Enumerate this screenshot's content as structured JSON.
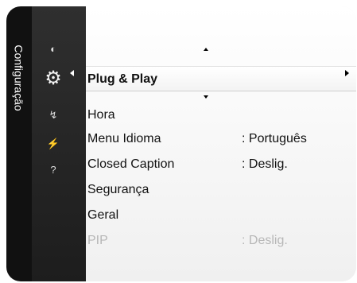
{
  "sidebar": {
    "title": "Configuração",
    "icons": [
      "picture-icon",
      "setup-gear-icon",
      "input-icon",
      "application-icon",
      "support-icon"
    ]
  },
  "menu": {
    "selected": {
      "label": "Plug & Play",
      "has_submenu": true
    },
    "items": [
      {
        "label": "Hora",
        "value": ""
      },
      {
        "label": "Menu Idioma",
        "value": ": Português"
      },
      {
        "label": "Closed Caption",
        "value": ": Deslig."
      },
      {
        "label": "Segurança",
        "value": ""
      },
      {
        "label": "Geral",
        "value": ""
      },
      {
        "label": "PIP",
        "value": ": Deslig.",
        "disabled": true
      }
    ]
  },
  "colors": {
    "selection_text": "#000000",
    "disabled_text": "#b7b7b7",
    "sidebar_bg": "#111111"
  }
}
